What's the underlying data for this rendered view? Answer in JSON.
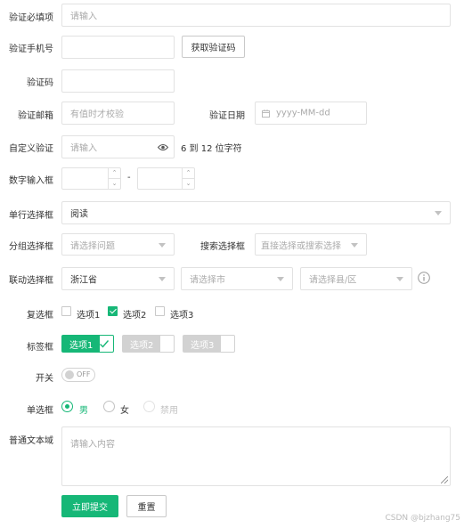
{
  "form": {
    "required": {
      "label": "验证必填项",
      "placeholder": "请输入"
    },
    "phone": {
      "label": "验证手机号",
      "button": "获取验证码"
    },
    "code": {
      "label": "验证码"
    },
    "email": {
      "label": "验证邮箱",
      "placeholder": "有值时才校验"
    },
    "date": {
      "label": "验证日期",
      "placeholder": "yyyy-MM-dd",
      "icon": "calendar-icon"
    },
    "custom": {
      "label": "自定义验证",
      "placeholder": "请输入",
      "hint": "6 到 12 位字符",
      "icon": "eye-icon"
    },
    "number": {
      "label": "数字输入框",
      "separator": "-"
    },
    "single_select": {
      "label": "单行选择框",
      "value": "阅读"
    },
    "group_select": {
      "label": "分组选择框",
      "placeholder": "请选择问题"
    },
    "search_select": {
      "label": "搜索选择框",
      "placeholder": "直接选择或搜索选择"
    },
    "linkage": {
      "label": "联动选择框",
      "province": "浙江省",
      "city_placeholder": "请选择市",
      "county_placeholder": "请选择县/区",
      "icon": "info-icon"
    },
    "checkbox": {
      "label": "复选框",
      "options": [
        "选项1",
        "选项2",
        "选项3"
      ],
      "checked": [
        false,
        true,
        false
      ]
    },
    "tags": {
      "label": "标签框",
      "options": [
        "选项1",
        "选项2",
        "选项3"
      ],
      "checked": [
        true,
        false,
        false
      ]
    },
    "switch": {
      "label": "开关",
      "state": "OFF"
    },
    "radio": {
      "label": "单选框",
      "options": [
        "男",
        "女",
        "禁用"
      ],
      "selected": 0,
      "disabled": [
        false,
        false,
        true
      ]
    },
    "textarea": {
      "label": "普通文本域",
      "placeholder": "请输入内容"
    },
    "submit": "立即提交",
    "reset": "重置"
  },
  "colors": {
    "accent": "#16b777"
  },
  "watermark": "CSDN @bjzhang75"
}
